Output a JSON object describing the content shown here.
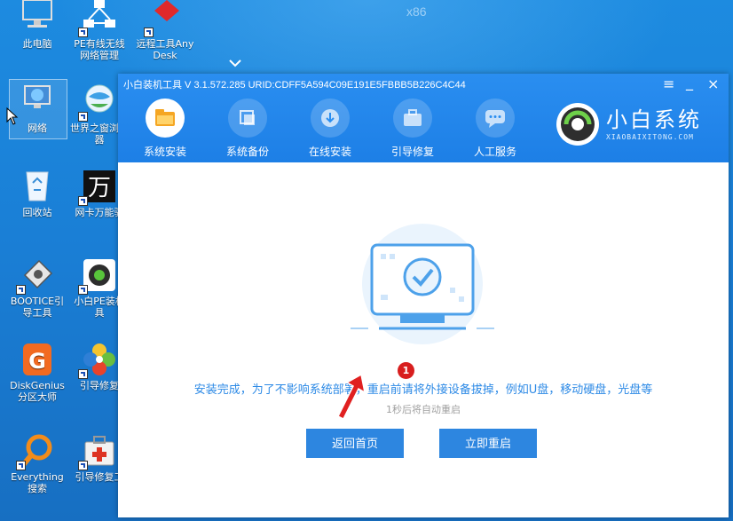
{
  "desktop": {
    "top_label": "x86",
    "icons": [
      {
        "label": "此电脑"
      },
      {
        "label": "PE有线无线网络管理"
      },
      {
        "label": "远程工具AnyDesk"
      },
      {
        "label": "网络"
      },
      {
        "label": "世界之窗浏览器"
      },
      {
        "label": "回收站"
      },
      {
        "label": "网卡万能驱"
      },
      {
        "label": "BOOTICE引导工具"
      },
      {
        "label": "小白PE装机具"
      },
      {
        "label": "DiskGenius分区大师"
      },
      {
        "label": "引导修复"
      },
      {
        "label": "Everything搜索"
      },
      {
        "label": "引导修复工"
      }
    ]
  },
  "window": {
    "title": "小白装机工具 V 3.1.572.285 URID:CDFF5A594C09E191E5FBBB5B226C4C44",
    "controls": {
      "menu": "≡",
      "minimize": "_",
      "close": "×"
    },
    "nav": [
      {
        "label": "系统安装",
        "active": true
      },
      {
        "label": "系统备份",
        "active": false
      },
      {
        "label": "在线安装",
        "active": false
      },
      {
        "label": "引导修复",
        "active": false
      },
      {
        "label": "人工服务",
        "active": false
      }
    ],
    "brand": {
      "name": "小白系统",
      "url": "XIAOBAIXITONG.COM"
    },
    "message": "安装完成，为了不影响系统部署，重启前请将外接设备拔掉，例如U盘，移动硬盘，光盘等",
    "countdown": "1秒后将自动重启",
    "buttons": {
      "back": "返回首页",
      "restart": "立即重启"
    },
    "badge": "1"
  },
  "colors": {
    "accent": "#2d86e0",
    "desktop": "#1a7fd6",
    "badge": "#d81e1e"
  }
}
